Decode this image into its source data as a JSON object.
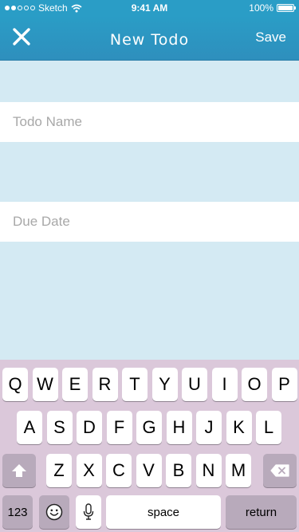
{
  "status_bar": {
    "carrier": "Sketch",
    "time": "9:41 AM",
    "battery": "100%",
    "signal_icon": "signal-dots-icon",
    "wifi_icon": "wifi-icon",
    "battery_icon": "battery-icon"
  },
  "nav": {
    "title": "New Todo",
    "save_label": "Save",
    "close_icon": "close-x-icon",
    "color": "#2a9dc6"
  },
  "form": {
    "todo_name_placeholder": "Todo Name",
    "due_date_placeholder": "Due Date",
    "todo_name_value": "",
    "due_date_value": ""
  },
  "keyboard": {
    "row1": [
      "Q",
      "W",
      "E",
      "R",
      "T",
      "Y",
      "U",
      "I",
      "O",
      "P"
    ],
    "row2": [
      "A",
      "S",
      "D",
      "F",
      "G",
      "H",
      "J",
      "K",
      "L"
    ],
    "row3": [
      "Z",
      "X",
      "C",
      "V",
      "B",
      "N",
      "M"
    ],
    "numbers_label": "123",
    "space_label": "space",
    "return_label": "return",
    "shift_icon": "shift-arrow-icon",
    "delete_icon": "backspace-icon",
    "emoji_icon": "emoji-icon",
    "mic_icon": "microphone-icon",
    "background": "#dbc8da"
  }
}
